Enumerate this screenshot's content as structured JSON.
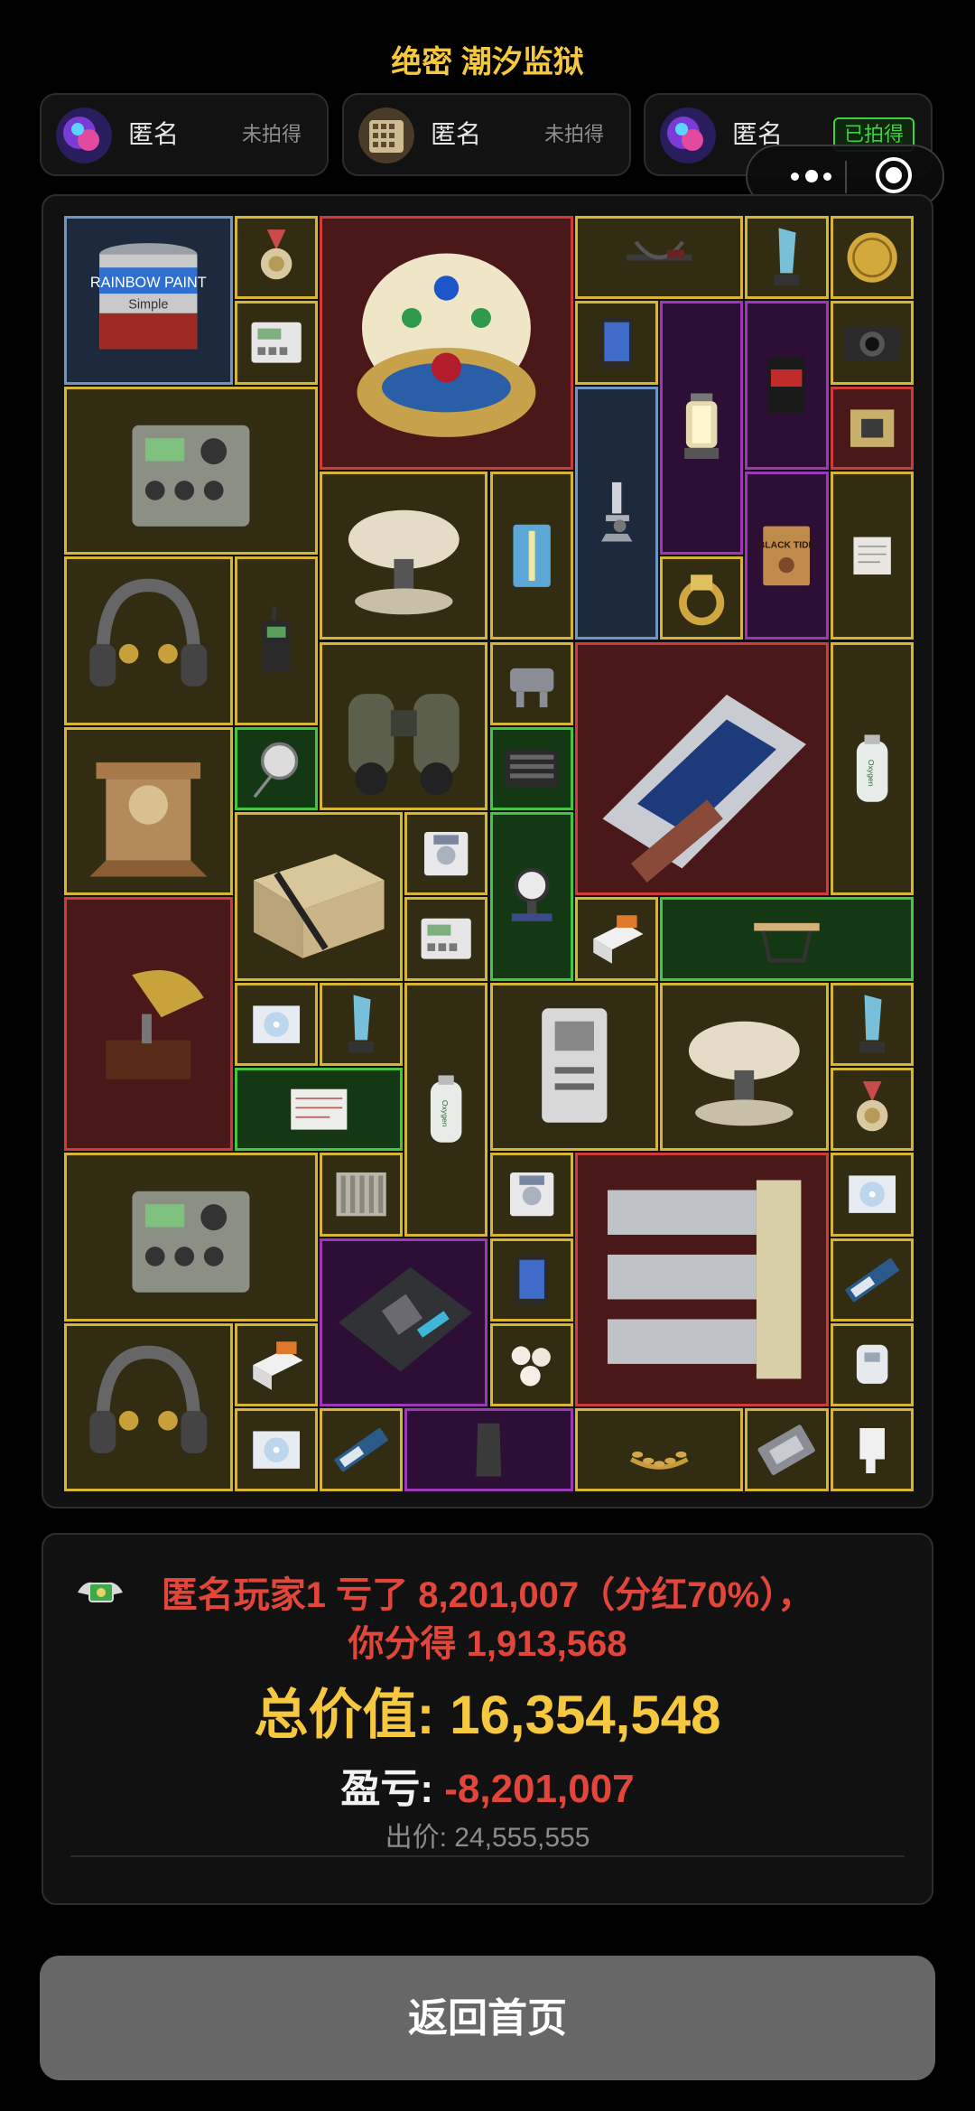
{
  "header": {
    "title": "绝密 潮汐监狱"
  },
  "players": [
    {
      "name": "匿名",
      "status": "未拍得",
      "won": false
    },
    {
      "name": "匿名",
      "status": "未拍得",
      "won": false
    },
    {
      "name": "匿名",
      "status": "已拍得",
      "won": true
    }
  ],
  "miniapp_capsule": {
    "menu_icon": "more-dots-icon",
    "close_icon": "target-circle-icon"
  },
  "rarity_colors": {
    "gold": "#d7b534",
    "red": "#cf3b3b",
    "purple": "#9a38b8",
    "green": "#44c644",
    "blue": "#6f95c8"
  },
  "items": [
    {
      "name": "paint-can",
      "rarity": "blue",
      "label": "RAINBOW PAINT Simple"
    },
    {
      "name": "medal",
      "rarity": "gold"
    },
    {
      "name": "jeweled-egg",
      "rarity": "red"
    },
    {
      "name": "crossbow",
      "rarity": "gold"
    },
    {
      "name": "crystal-trophy",
      "rarity": "gold"
    },
    {
      "name": "gold-coin",
      "rarity": "gold"
    },
    {
      "name": "power-meter",
      "rarity": "gold"
    },
    {
      "name": "smartphone",
      "rarity": "gold"
    },
    {
      "name": "lantern",
      "rarity": "purple"
    },
    {
      "name": "snack-pack",
      "rarity": "purple"
    },
    {
      "name": "camera",
      "rarity": "gold"
    },
    {
      "name": "field-radio",
      "rarity": "gold"
    },
    {
      "name": "circuit-module",
      "rarity": "red"
    },
    {
      "name": "microscope",
      "rarity": "blue"
    },
    {
      "name": "satellite-dish",
      "rarity": "gold"
    },
    {
      "name": "syringe-kit",
      "rarity": "gold"
    },
    {
      "name": "black-tide-book",
      "rarity": "purple",
      "label": "BLACK TIDE"
    },
    {
      "name": "document",
      "rarity": "gold"
    },
    {
      "name": "gold-ring",
      "rarity": "gold"
    },
    {
      "name": "headset",
      "rarity": "gold"
    },
    {
      "name": "walkie-talkie",
      "rarity": "gold"
    },
    {
      "name": "binoculars",
      "rarity": "gold"
    },
    {
      "name": "connector",
      "rarity": "gold"
    },
    {
      "name": "server-rack",
      "rarity": "red"
    },
    {
      "name": "oxygen-tank",
      "rarity": "gold",
      "label": "Oxygen"
    },
    {
      "name": "mantel-clock",
      "rarity": "gold"
    },
    {
      "name": "gauge-probe",
      "rarity": "green"
    },
    {
      "name": "gpu-block",
      "rarity": "green"
    },
    {
      "name": "ammo-crate",
      "rarity": "gold"
    },
    {
      "name": "floppy-disk",
      "rarity": "gold"
    },
    {
      "name": "pressure-gauge",
      "rarity": "green"
    },
    {
      "name": "power-meter",
      "rarity": "gold"
    },
    {
      "name": "pill-box",
      "rarity": "gold"
    },
    {
      "name": "hacksaw",
      "rarity": "green"
    },
    {
      "name": "gramophone",
      "rarity": "red"
    },
    {
      "name": "cd-disc",
      "rarity": "gold"
    },
    {
      "name": "crystal-trophy",
      "rarity": "gold"
    },
    {
      "name": "oxygen-tank",
      "rarity": "gold",
      "label": "Oxygen"
    },
    {
      "name": "id-card",
      "rarity": "gold"
    },
    {
      "name": "satellite-dish",
      "rarity": "gold"
    },
    {
      "name": "crystal-trophy",
      "rarity": "gold"
    },
    {
      "name": "paper-form",
      "rarity": "green"
    },
    {
      "name": "medal",
      "rarity": "gold"
    },
    {
      "name": "field-radio",
      "rarity": "gold"
    },
    {
      "name": "heatsink",
      "rarity": "gold"
    },
    {
      "name": "floppy-disk",
      "rarity": "gold"
    },
    {
      "name": "radiator-unit",
      "rarity": "red"
    },
    {
      "name": "cd-disc",
      "rarity": "gold"
    },
    {
      "name": "motherboard",
      "rarity": "purple"
    },
    {
      "name": "smartphone",
      "rarity": "gold"
    },
    {
      "name": "ssd-stick",
      "rarity": "gold"
    },
    {
      "name": "headset",
      "rarity": "gold"
    },
    {
      "name": "pill-box",
      "rarity": "gold"
    },
    {
      "name": "pearls",
      "rarity": "gold"
    },
    {
      "name": "usb-dongle",
      "rarity": "gold"
    },
    {
      "name": "cd-disc",
      "rarity": "gold"
    },
    {
      "name": "ssd-stick",
      "rarity": "gold"
    },
    {
      "name": "body-armor-plate",
      "rarity": "purple"
    },
    {
      "name": "laurel-crown",
      "rarity": "gold"
    },
    {
      "name": "cpu-chip",
      "rarity": "gold"
    },
    {
      "name": "inhaler",
      "rarity": "gold"
    }
  ],
  "result": {
    "summary_line1": "匿名玩家1 亏了 8,201,007（分红70%），",
    "summary_line2": "你分得 1,913,568",
    "total_label": "总价值: 16,354,548",
    "profit_label": "盈亏: ",
    "profit_value": "-8,201,007",
    "bid_label": "出价: 24,555,555"
  },
  "footer": {
    "home_button": "返回首页"
  }
}
